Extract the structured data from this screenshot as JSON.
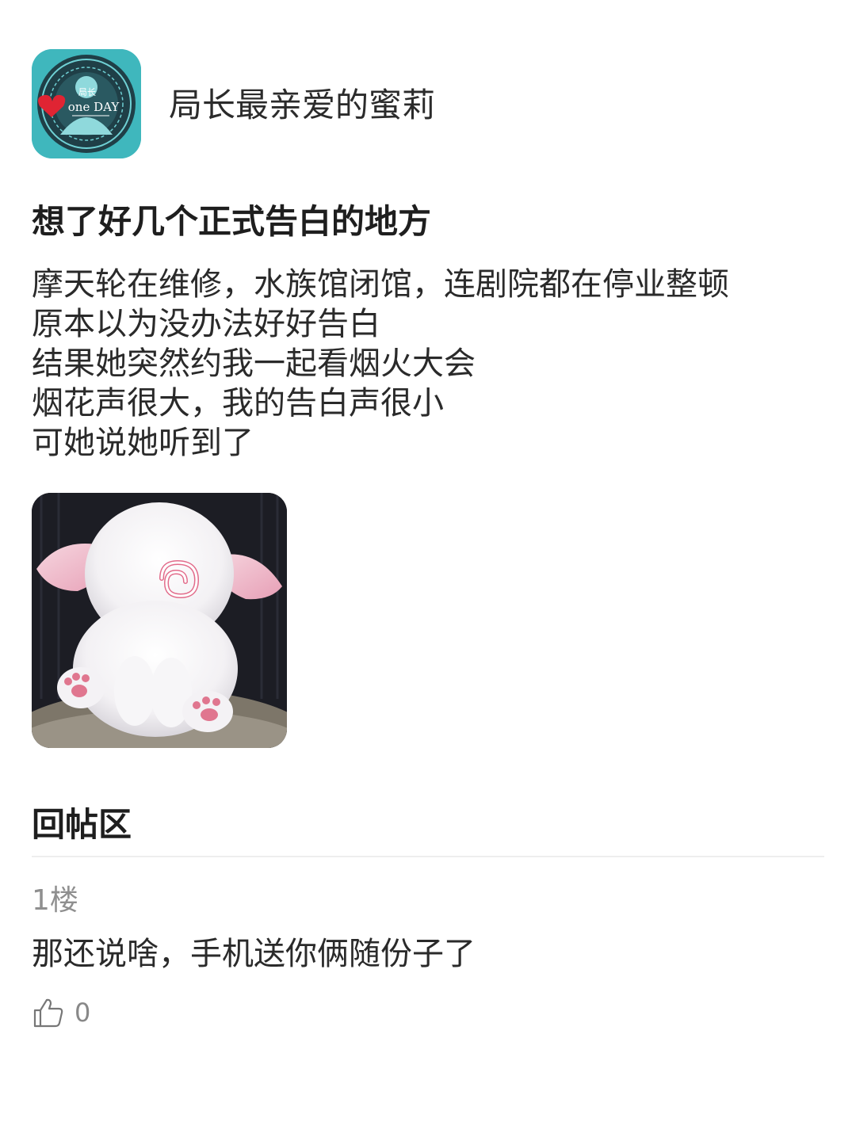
{
  "author": {
    "name": "局长最亲爱的蜜莉",
    "avatar": {
      "icon": "avatar-badge-icon",
      "badge_top": "局长",
      "badge_text": "one DAY",
      "color": "#3fb7bd"
    }
  },
  "post": {
    "title": "想了好几个正式告白的地方",
    "lines": [
      "摩天轮在维修，水族馆闭馆，连剧院都在停业整顿",
      "原本以为没办法好好告白",
      "结果她突然约我一起看烟火大会",
      "烟花声很大，我的告白声很小",
      "可她说她听到了"
    ],
    "image": {
      "icon": "white-kitten-photo"
    }
  },
  "replies": {
    "heading": "回帖区",
    "items": [
      {
        "floor": "1楼",
        "text": "那还说啥，手机送你俩随份子了",
        "likes": "0",
        "like_icon": "thumbs-up-icon"
      }
    ]
  }
}
